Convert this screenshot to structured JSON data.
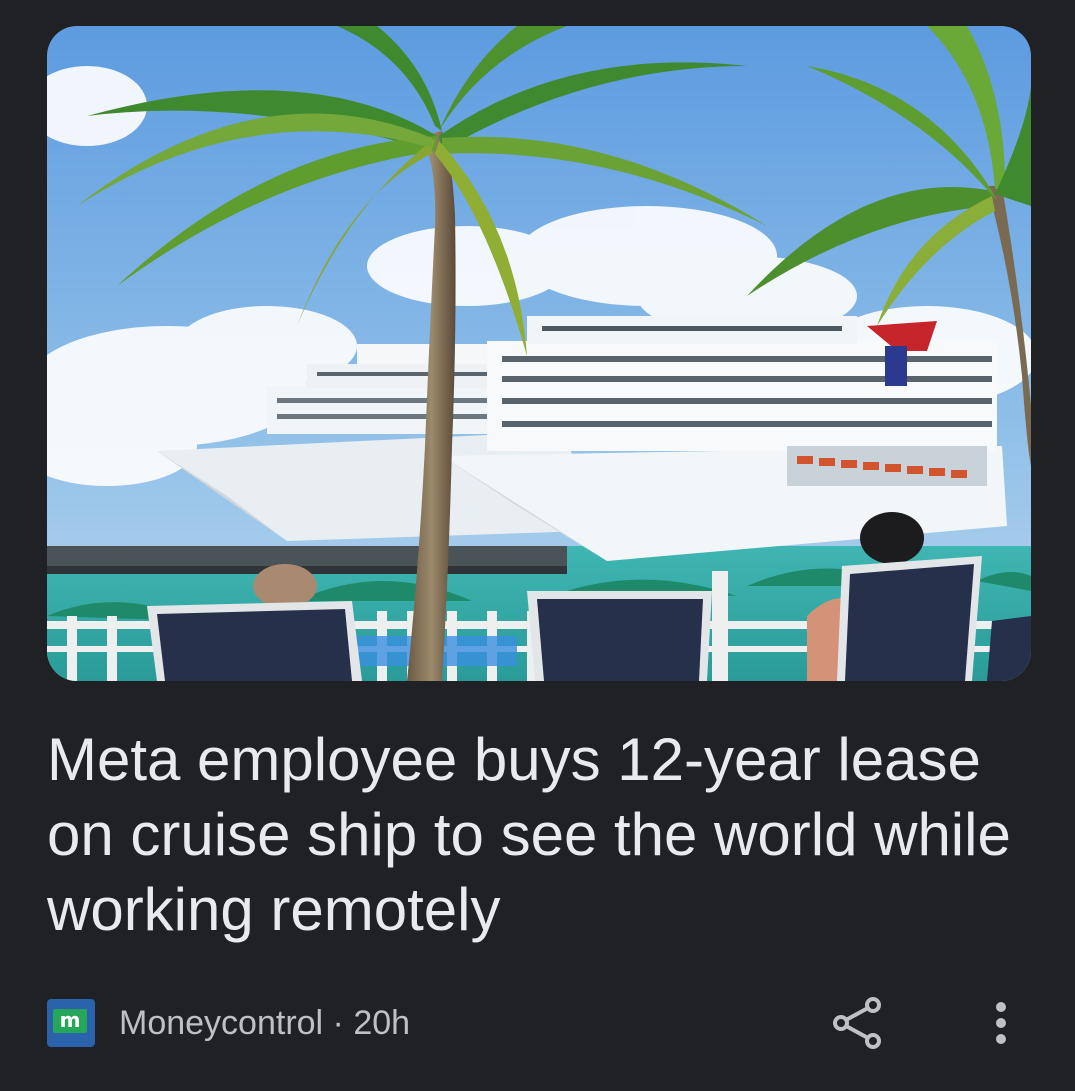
{
  "article": {
    "image_alt": "Two cruise ships docked behind palm trees",
    "headline": "Meta employee buys 12-year lease on cruise ship to see the world while working remotely",
    "source": {
      "logo_letter": "m",
      "name": "Moneycontrol",
      "separator": " · ",
      "age": "20h"
    }
  },
  "icons": {
    "share": "share-icon",
    "more": "more-vertical-icon"
  },
  "colors": {
    "background": "#202124",
    "headline": "#e8eaed",
    "meta_text": "#bdc1c6",
    "logo_blue": "#2a62ac",
    "logo_green": "#26a65b"
  }
}
